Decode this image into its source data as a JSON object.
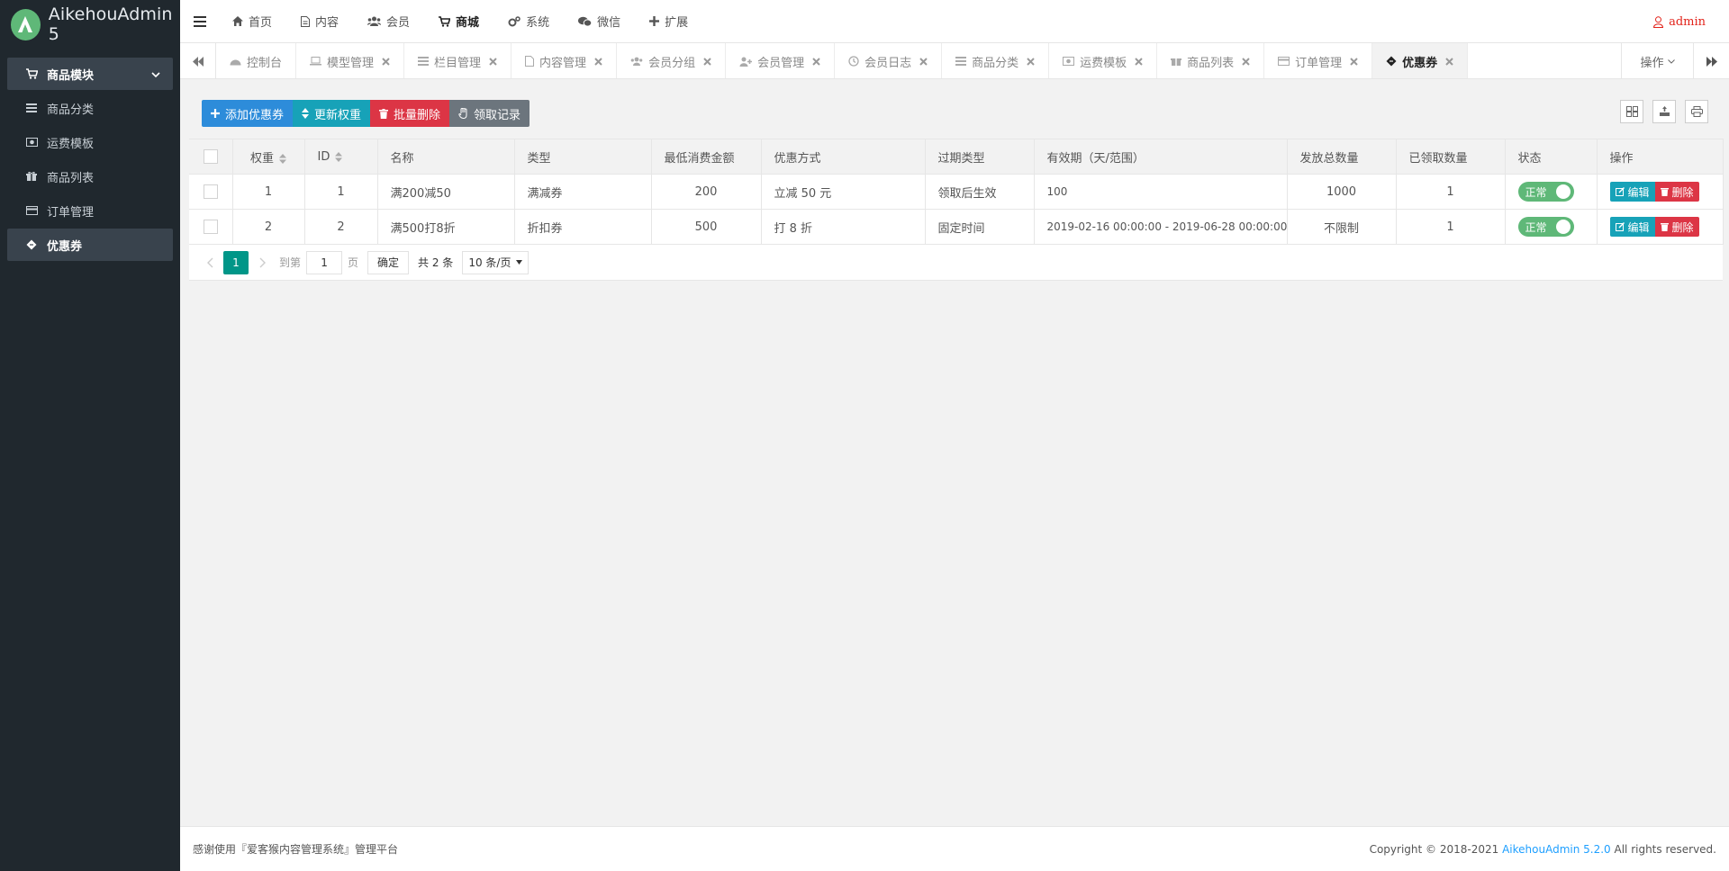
{
  "app": {
    "title": "AikehouAdmin 5",
    "logo_icon": "aikehou-logo",
    "accent": "#5fb878"
  },
  "sidebar": {
    "parent": {
      "label": "商品模块",
      "icon": "cart-icon"
    },
    "items": [
      {
        "label": "商品分类",
        "icon": "list-icon"
      },
      {
        "label": "运费模板",
        "icon": "money-icon"
      },
      {
        "label": "商品列表",
        "icon": "gift-icon"
      },
      {
        "label": "订单管理",
        "icon": "card-icon"
      },
      {
        "label": "优惠券",
        "icon": "ticket-icon",
        "active": true
      }
    ]
  },
  "header": {
    "nav": [
      {
        "label": "首页",
        "icon": "home-icon"
      },
      {
        "label": "内容",
        "icon": "file-icon"
      },
      {
        "label": "会员",
        "icon": "users-icon"
      },
      {
        "label": "商城",
        "icon": "cart-icon",
        "active": true
      },
      {
        "label": "系统",
        "icon": "cogs-icon"
      },
      {
        "label": "微信",
        "icon": "wechat-icon"
      },
      {
        "label": "扩展",
        "icon": "plus-icon"
      }
    ],
    "user": "admin"
  },
  "tabs": {
    "items": [
      {
        "label": "控制台",
        "icon": "dashboard-icon",
        "closable": false
      },
      {
        "label": "模型管理",
        "icon": "laptop-icon",
        "closable": true
      },
      {
        "label": "栏目管理",
        "icon": "list-icon",
        "closable": true
      },
      {
        "label": "内容管理",
        "icon": "file-icon",
        "closable": true
      },
      {
        "label": "会员分组",
        "icon": "users-icon",
        "closable": true
      },
      {
        "label": "会员管理",
        "icon": "user-plus-icon",
        "closable": true
      },
      {
        "label": "会员日志",
        "icon": "history-icon",
        "closable": true
      },
      {
        "label": "商品分类",
        "icon": "list-icon",
        "closable": true
      },
      {
        "label": "运费模板",
        "icon": "money-icon",
        "closable": true
      },
      {
        "label": "商品列表",
        "icon": "gift-icon",
        "closable": true
      },
      {
        "label": "订单管理",
        "icon": "card-icon",
        "closable": true
      },
      {
        "label": "优惠券",
        "icon": "ticket-icon",
        "closable": true,
        "active": true
      }
    ],
    "ops_label": "操作"
  },
  "toolbar": {
    "add": "添加优惠券",
    "update_weight": "更新权重",
    "batch_delete": "批量删除",
    "records": "领取记录"
  },
  "table": {
    "columns": [
      "权重",
      "ID",
      "名称",
      "类型",
      "最低消费金额",
      "优惠方式",
      "过期类型",
      "有效期（天/范围）",
      "发放总数量",
      "已领取数量",
      "状态",
      "操作"
    ],
    "rows": [
      {
        "weight": "1",
        "id": "1",
        "name": "满200减50",
        "type": "满减券",
        "min": "200",
        "discount": "立减 50 元",
        "expire_type": "领取后生效",
        "valid": "100",
        "total": "1000",
        "claimed": "1",
        "status": "正常"
      },
      {
        "weight": "2",
        "id": "2",
        "name": "满500打8折",
        "type": "折扣券",
        "min": "500",
        "discount": "打 8 折",
        "expire_type": "固定时间",
        "valid": "2019-02-16 00:00:00 - 2019-06-28 00:00:00",
        "total": "不限制",
        "claimed": "1",
        "status": "正常"
      }
    ],
    "edit_label": "编辑",
    "delete_label": "删除"
  },
  "pager": {
    "current": "1",
    "goto_label": "到第",
    "page_value": "1",
    "page_unit": "页",
    "confirm": "确定",
    "total": "共 2 条",
    "page_size": "10 条/页"
  },
  "footer": {
    "left": "感谢使用『爱客猴内容管理系统』管理平台",
    "copyright_prefix": "Copyright © 2018-2021",
    "brand": "AikehouAdmin 5.2.0",
    "copyright_suffix": "All rights reserved."
  }
}
